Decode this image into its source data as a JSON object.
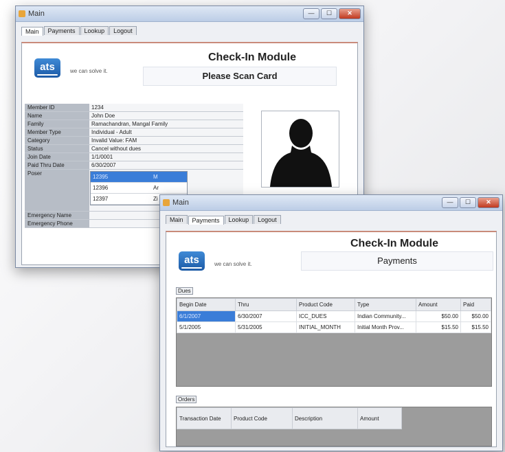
{
  "back_window": {
    "title": "Main",
    "tabs": [
      "Main",
      "Payments",
      "Lookup",
      "Logout"
    ],
    "controls": {
      "minimize": "—",
      "maximize": "☐",
      "close": "✕"
    },
    "logo_text": "ats",
    "slogan": "we can solve it.",
    "heading": "Check-In Module",
    "subheading": "Please Scan Card",
    "fields": [
      {
        "label": "Member ID",
        "value": "1234"
      },
      {
        "label": "Name",
        "value": "John Doe"
      },
      {
        "label": "Family",
        "value": "Ramachandran, Mangal Family"
      },
      {
        "label": "Member Type",
        "value": "Individual - Adult"
      },
      {
        "label": "Category",
        "value": "Invalid Value: FAM"
      },
      {
        "label": "Status",
        "value": "Cancel without dues"
      },
      {
        "label": "Join Date",
        "value": "1/1/0001"
      },
      {
        "label": "Paid Thru Date",
        "value": "6/30/2007"
      },
      {
        "label": "Poser",
        "value": ""
      }
    ],
    "poser_rows": [
      {
        "id": "12395",
        "code": "M"
      },
      {
        "id": "12396",
        "code": "Ar"
      },
      {
        "id": "12397",
        "code": "Zi"
      }
    ],
    "extra_labels": [
      "Emergency Name",
      "Emergency Phone"
    ]
  },
  "front_window": {
    "title": "Main",
    "tabs": [
      "Main",
      "Payments",
      "Lookup",
      "Logout"
    ],
    "controls": {
      "minimize": "—",
      "maximize": "☐",
      "close": "✕"
    },
    "logo_text": "ats",
    "slogan": "we can solve it.",
    "heading": "Check-In Module",
    "subheading": "Payments",
    "dues_label": "Dues",
    "dues_columns": [
      "Begin Date",
      "Thru",
      "Product Code",
      "Type",
      "Amount",
      "Paid"
    ],
    "dues_rows": [
      [
        "6/1/2007",
        "6/30/2007",
        "ICC_DUES",
        "Indian Community...",
        "$50.00",
        "$50.00"
      ],
      [
        "5/1/2005",
        "5/31/2005",
        "INITIAL_MONTH",
        "Initial Month Prov...",
        "$15.50",
        "$15.50"
      ]
    ],
    "orders_label": "Orders",
    "orders_columns": [
      "Transaction Date",
      "Product Code",
      "Description",
      "Amount"
    ]
  }
}
